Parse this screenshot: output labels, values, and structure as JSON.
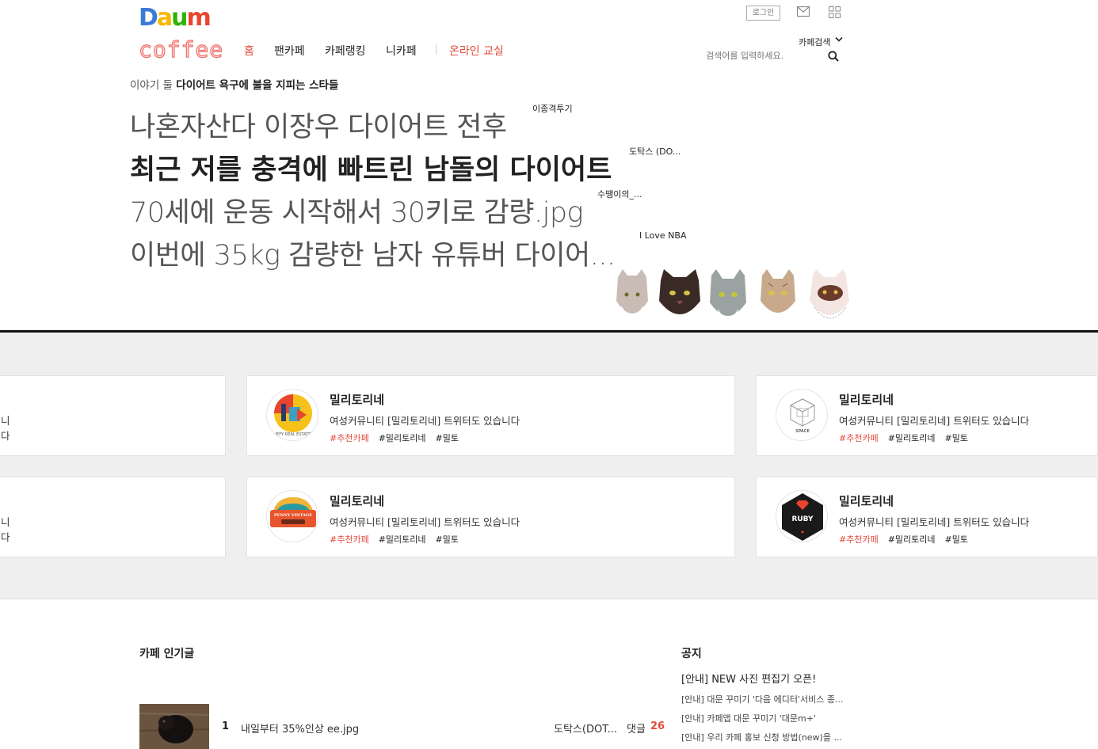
{
  "header": {
    "logo_text": "Daum",
    "cafe_logo": "coffee",
    "nav": [
      "홈",
      "팬카페",
      "카페랭킹",
      "니카페",
      "온라인 교실"
    ],
    "login_label": "로그인",
    "search_type": "카페검색",
    "search_placeholder": "검색어를 입력하세요."
  },
  "story": {
    "label_prefix": "이야기 둘",
    "label_title": "다이어트 욕구에 불을 지피는 스타들",
    "headlines": [
      {
        "title": "나혼자산다 이장우 다이어트 전후",
        "author": "이종격투기"
      },
      {
        "title": "최근 저를 충격에 빠트린 남돌의 다이어트",
        "author": "도탁스 (DO..."
      },
      {
        "title": "70세에 운동 시작해서 30키로 감량.jpg",
        "author": "수땡이의_..."
      },
      {
        "title": "이번에 35kg 감량한 남자 유튜버 다이어...",
        "author": "I Love NBA"
      }
    ]
  },
  "cards": {
    "partial_desc": "니다",
    "items": [
      {
        "name": "밀리토리네",
        "desc": "여성커뮤니티 [밀리토리네] 트위터도 있습니다",
        "tags": [
          "#추천카페",
          "#밀리토리네",
          "#밀토"
        ],
        "thumb_text": "IEFY REAL ESTATE"
      },
      {
        "name": "밀리토리네",
        "desc": "여성커뮤니티 [밀리토리네] 트위터도 있습니다",
        "tags": [
          "#추천카페",
          "#밀리토리네",
          "#밀토"
        ],
        "thumb_text": "SPACE"
      },
      {
        "name": "밀리토리네",
        "desc": "여성커뮤니티 [밀리토리네] 트위터도 있습니다",
        "tags": [
          "#추천카페",
          "#밀리토리네",
          "#밀토"
        ],
        "thumb_text": "PENNY VINTAGE"
      },
      {
        "name": "밀리토리네",
        "desc": "여성커뮤니티 [밀리토리네] 트위터도 있습니다",
        "tags": [
          "#추천카페",
          "#밀리토리네",
          "#밀토"
        ],
        "thumb_text": "RUBY"
      }
    ]
  },
  "popular": {
    "title": "카페 인기글",
    "items": [
      {
        "rank": "1",
        "title": "내일부터 35%인상 ee.jpg",
        "author": "도탁스(DOT...",
        "comment_label": "댓글",
        "comment_count": "26"
      }
    ]
  },
  "notice": {
    "title": "공지",
    "main": "[안내] NEW 사진 편집기 오픈!",
    "items": [
      "[안내] 대문 꾸미기 '다음 에디터'서비스 종...",
      "[안내] 카페앱 대문 꾸미기 '대문m+'",
      "[안내] 우리 카페 홍보 신청 방법(new)을 ..."
    ]
  },
  "colors": {
    "accent": "#e34b3c",
    "card_bg": "#efefef",
    "divider": "#111111"
  }
}
